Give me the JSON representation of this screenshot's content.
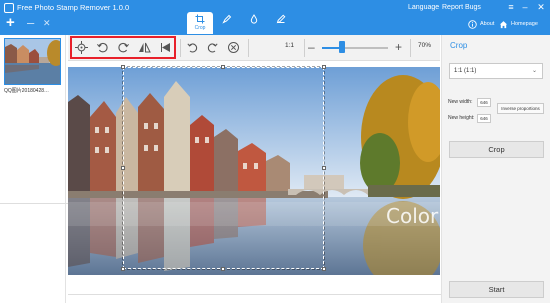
{
  "app": {
    "title": "Free Photo Stamp Remover 1.0.0",
    "menu_language": "Language",
    "menu_report": "Report Bugs",
    "about": "About",
    "homepage": "Homepage",
    "brand_color": "#2d8ee4"
  },
  "tabs": [
    {
      "label": "Crop",
      "icon": "crop-icon",
      "active": true
    },
    {
      "label": "",
      "icon": "brush-icon",
      "active": false
    },
    {
      "label": "",
      "icon": "drop-icon",
      "active": false
    },
    {
      "label": "",
      "icon": "pen-icon",
      "active": false
    }
  ],
  "left_panel": {
    "thumbnail_name": "QQ图片20180428…"
  },
  "toolbar": {
    "one_to_one": "1:1",
    "zoom_percent": "70%",
    "zoom_value": 0.3,
    "highlight_color": "#e8202a",
    "tools": [
      "center-icon",
      "rotate-left-icon",
      "rotate-right-icon",
      "flip-horizontal-icon",
      "flip-vertical-icon",
      "undo-icon",
      "redo-icon",
      "reset-icon"
    ]
  },
  "canvas": {
    "watermark": "ColorMango.com"
  },
  "right_panel": {
    "title": "Crop",
    "ratio_selected": "1:1 (1:1)",
    "new_width_label": "New width:",
    "new_width_value": "646",
    "new_height_label": "New height:",
    "new_height_value": "646",
    "inverse_label": "Inverse proportions",
    "crop_button": "Crop",
    "start_button": "Start"
  }
}
